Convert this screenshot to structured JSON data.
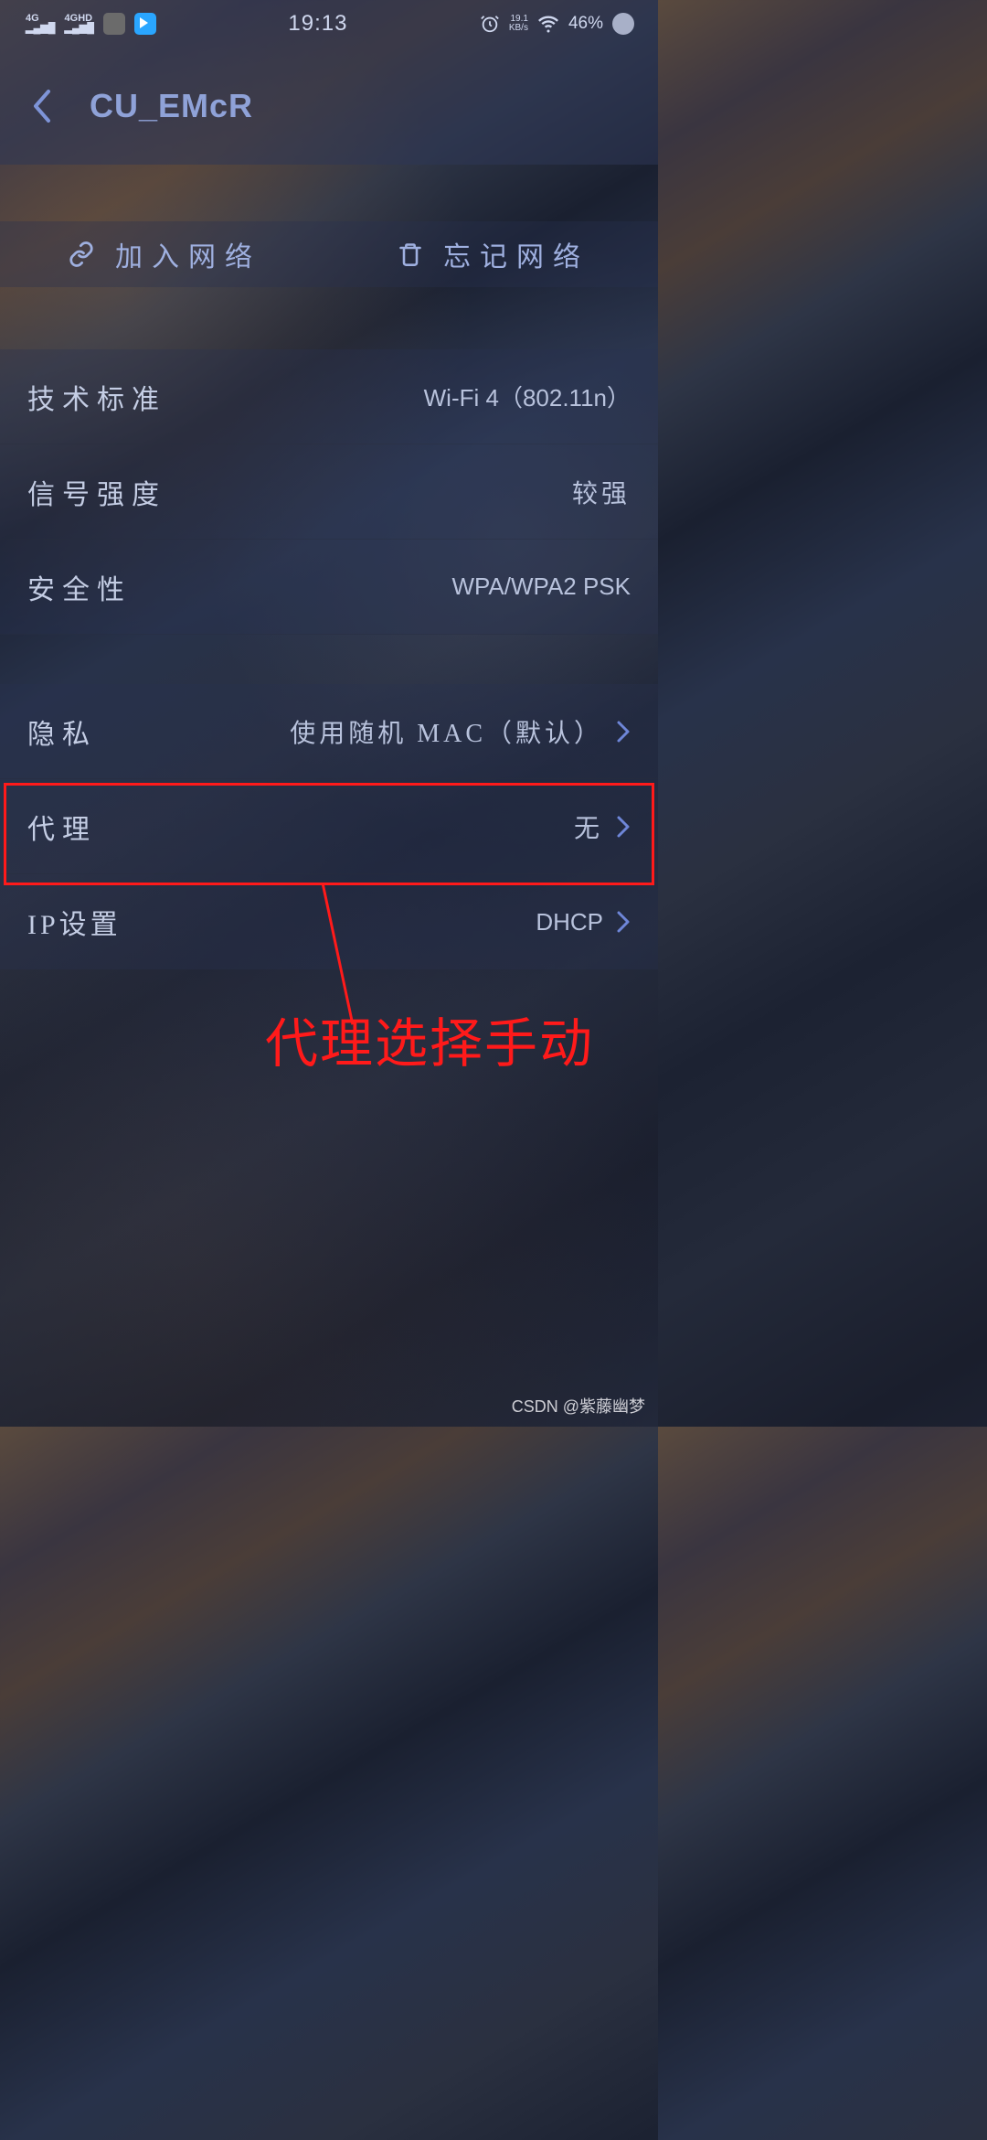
{
  "status": {
    "net_a": "4G",
    "net_b": "4GHD",
    "time": "19:13",
    "speed_val": "19.1",
    "speed_unit": "KB/s",
    "battery": "46%"
  },
  "header": {
    "title": "CU_EMcR"
  },
  "actions": {
    "join": "加入网络",
    "forget": "忘记网络"
  },
  "rows": {
    "tech_label": "技术标准",
    "tech_value": "Wi-Fi 4（802.11n）",
    "signal_label": "信号强度",
    "signal_value": "较强",
    "security_label": "安全性",
    "security_value": "WPA/WPA2 PSK",
    "privacy_label": "隐私",
    "privacy_value": "使用随机 MAC（默认）",
    "proxy_label": "代理",
    "proxy_value": "无",
    "ip_label": "IP设置",
    "ip_value": "DHCP"
  },
  "annotation": "代理选择手动",
  "watermark": "CSDN @紫藤幽梦"
}
